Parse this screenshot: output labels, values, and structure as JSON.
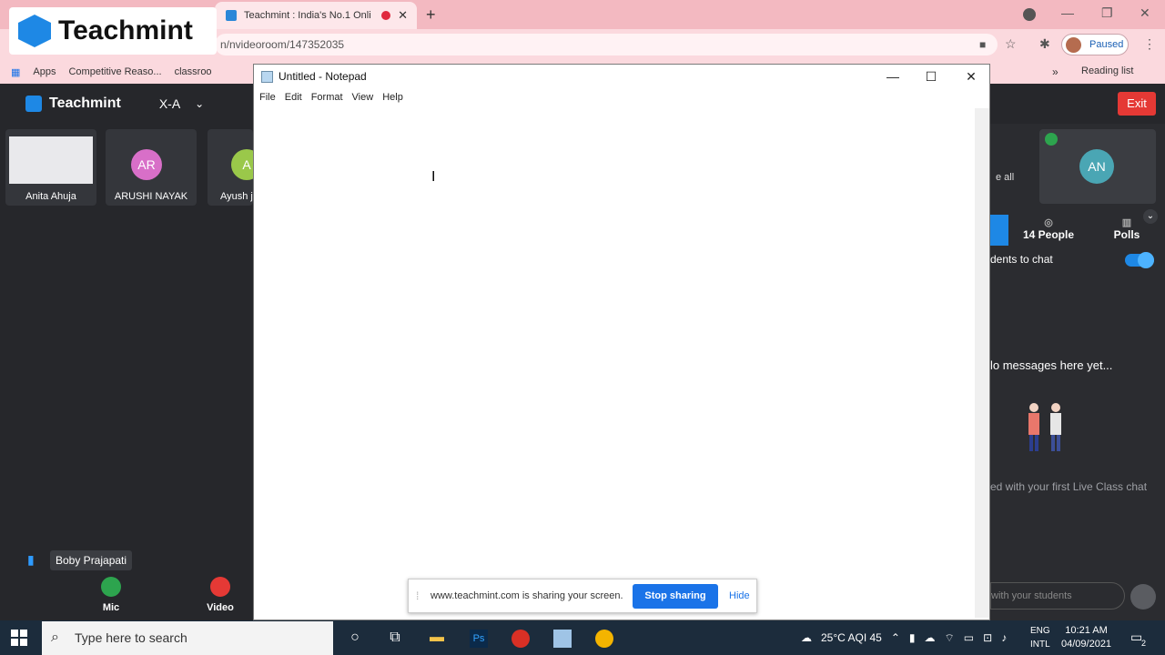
{
  "browser": {
    "tab_title": "Teachmint : India's No.1 Onli",
    "address": "n/nvideoroom/147352035",
    "profile_status": "Paused",
    "bookmarks": [
      "Apps",
      "Competitive Reaso...",
      "classroo"
    ],
    "reading_list": "Reading list"
  },
  "logo_text": "Teachmint",
  "app": {
    "brand": "Teachmint",
    "class_name": "X-A",
    "exit_label": "Exit",
    "participants": [
      {
        "name": "Anita Ahuja",
        "initials": ""
      },
      {
        "name": "ARUSHI NAYAK",
        "initials": "AR",
        "color": "#d86fc8"
      },
      {
        "name": "Ayush j",
        "initials": "A",
        "color": "#9ac84a"
      }
    ],
    "right_avatar": "AN",
    "see_all": "e all",
    "people_tab": "14 People",
    "polls_tab": "Polls",
    "allow_chat": "dents to chat",
    "no_messages": "lo messages here yet...",
    "first_chat": "ed with your first Live Class chat",
    "chat_placeholder": "with your students",
    "speaker_name": "Boby Prajapati",
    "mic_label": "Mic",
    "video_label": "Video"
  },
  "notepad": {
    "title": "Untitled - Notepad",
    "menu": [
      "File",
      "Edit",
      "Format",
      "View",
      "Help"
    ]
  },
  "share_bar": {
    "message": "www.teachmint.com is sharing your screen.",
    "stop": "Stop sharing",
    "hide": "Hide"
  },
  "taskbar": {
    "search_placeholder": "Type here to search",
    "weather": "25°C AQI 45",
    "lang_top": "ENG",
    "lang_bottom": "INTL",
    "time": "10:21 AM",
    "date": "04/09/2021",
    "notification_count": "2"
  }
}
